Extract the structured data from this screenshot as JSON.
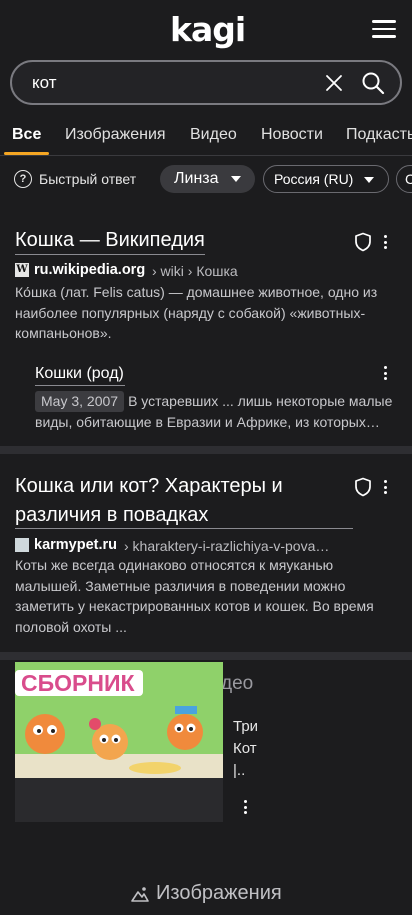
{
  "app": {
    "logo": "kagi"
  },
  "search": {
    "query": "кот"
  },
  "tabs": [
    {
      "label": "Все",
      "active": true
    },
    {
      "label": "Изображения"
    },
    {
      "label": "Видео"
    },
    {
      "label": "Новости"
    },
    {
      "label": "Подкасты"
    }
  ],
  "filters": {
    "quick_answer": "Быстрый ответ",
    "lens": "Линза",
    "region": "Россия (RU)",
    "more": "С"
  },
  "results": [
    {
      "title": "Кошка — Википедия",
      "favicon": "W",
      "domain": "ru.wikipedia.org",
      "path": "› wiki › Кошка",
      "snippet": "Ко́шка (лат. Felis catus) — домашнее животное, одно из наиболее популярных (наряду с собакой) «животных-компаньонов».",
      "sub": {
        "title": "Кошки (род)",
        "date": "May 3, 2007",
        "snippet": "В устаревших ... лишь некоторые малые виды, обитающие в Евразии и Африке, из которых…"
      }
    },
    {
      "title_line1": "Кошка или кот? Характеры и",
      "title_line2": "различия в повадках",
      "domain": "karmypet.ru",
      "path": "› kharaktery-i-razlichiya-v-pova…",
      "snippet": "Коты же всегда одинаково относятся к мяуканью малышей. Заметные различия в поведении можно заметить у некастрированных котов и кошек. Во время половой охоты ..."
    }
  ],
  "video": {
    "heading": "део",
    "thumb_text": "СБОРНИК",
    "line1": "Три",
    "line2": "Кот",
    "line3": "|.."
  },
  "images_section": {
    "label": "Изображения"
  },
  "colors": {
    "accent": "#f5a623",
    "background": "#1c1c1e"
  }
}
